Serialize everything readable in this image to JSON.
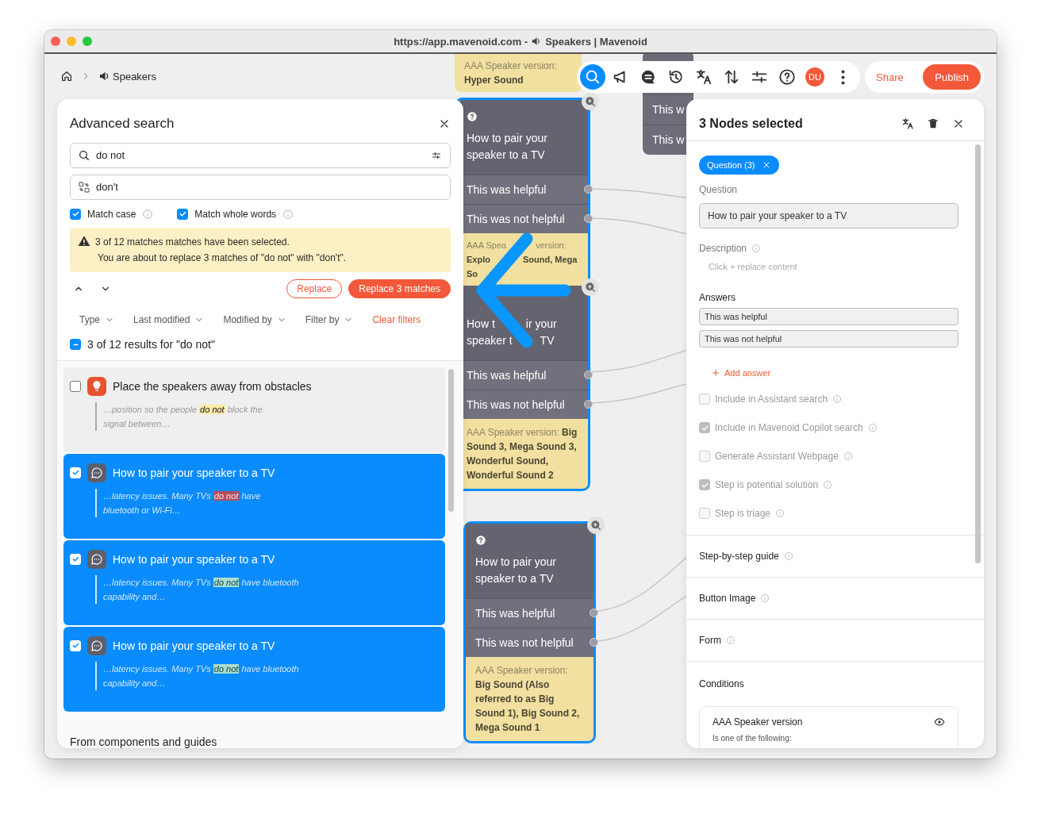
{
  "window": {
    "url": "https://app.mavenoid.com -",
    "title": "Speakers | Mavenoid"
  },
  "breadcrumb": {
    "current": "Speakers"
  },
  "toolbar": {
    "tools": [
      {
        "kind": "search",
        "selected": true
      },
      {
        "kind": "announce",
        "selected": false
      },
      {
        "kind": "chat",
        "selected": false
      },
      {
        "kind": "history",
        "selected": false
      },
      {
        "kind": "translate",
        "selected": false
      },
      {
        "kind": "sort",
        "selected": false
      },
      {
        "kind": "adjust",
        "selected": false
      },
      {
        "kind": "help",
        "selected": false
      }
    ],
    "avatar": "DU",
    "actions": [
      {
        "label": "Share",
        "kind": "text"
      },
      {
        "label": "Publish",
        "kind": "primary"
      }
    ]
  },
  "canvas": {
    "snippet": {
      "label": "AAA Speaker version:",
      "value": "Hyper Sound"
    },
    "groups": [
      {
        "selected": true,
        "nodes": [
          {
            "title": "How to pair your speaker to a TV",
            "answers": [
              "This was helpful",
              "This was not helpful"
            ],
            "condition_parts": {
              "label": [
                "AAA Spea",
                "version:"
              ],
              "value": [
                [
                  "Explo",
                  "Sound, Mega"
                ],
                [
                  "So"
                ]
              ]
            }
          },
          {
            "title_parts": [
              [
                "How t",
                "ir your"
              ],
              [
                "speaker t",
                "TV"
              ]
            ],
            "answers": [
              "This was helpful",
              "This was not helpful"
            ],
            "condition": {
              "label": "AAA Speaker version:",
              "value": "Big Sound 3, Mega Sound 3, Wonderful Sound, Wonderful Sound 2"
            }
          }
        ]
      },
      {
        "selected": true,
        "nodes": [
          {
            "title": "How to pair your speaker to a TV",
            "answers": [
              "This was helpful",
              "This was not helpful"
            ],
            "condition": {
              "label": "AAA Speaker version:",
              "value": "Big Sound (Also referred to as Big Sound 1), Big Sound 2, Mega Sound 1"
            }
          }
        ]
      }
    ],
    "side_node": {
      "answers": [
        "This w",
        "This w"
      ]
    }
  },
  "search_panel": {
    "title": "Advanced search",
    "query": "do not",
    "replacement": "don't",
    "options": [
      {
        "label": "Match case",
        "checked": true
      },
      {
        "label": "Match whole words",
        "checked": true
      }
    ],
    "notice": {
      "title": "3 of 12 matches matches have been selected.",
      "text": "You are about to replace 3 matches of \"do not\" with \"don't\"."
    },
    "buttons": [
      {
        "label": "Replace",
        "kind": "outline"
      },
      {
        "label": "Replace 3 matches",
        "kind": "primary"
      }
    ],
    "filters": [
      {
        "label": "Type",
        "kind": "dropdown"
      },
      {
        "label": "Last modified",
        "kind": "dropdown"
      },
      {
        "label": "Modified by",
        "kind": "dropdown"
      },
      {
        "label": "Filter by",
        "kind": "dropdown"
      },
      {
        "label": "Clear filters",
        "kind": "link"
      }
    ],
    "summary": {
      "text": "3 of 12 results for \"do not\"",
      "indeterminate": true
    },
    "results": [
      {
        "kind": "solution",
        "title": "Place the speakers away from obstacles",
        "selected": false,
        "current": false,
        "snippet": {
          "before": "…position so the people ",
          "match": "do not",
          "after": " block the\nsignal between…"
        }
      },
      {
        "kind": "question",
        "title": "How to pair your speaker to a TV",
        "selected": true,
        "current": true,
        "snippet": {
          "before": "…latency issues. Many TVs ",
          "match": "do not",
          "after": " have\nbluetooth or Wi-Fi…"
        }
      },
      {
        "kind": "question",
        "title": "How to pair your speaker to a TV",
        "selected": true,
        "current": false,
        "snippet": {
          "before": "…latency issues. Many TVs ",
          "match": "do not",
          "after": " have bluetooth\ncapability and…"
        }
      },
      {
        "kind": "question",
        "title": "How to pair your speaker to a TV",
        "selected": true,
        "current": false,
        "snippet": {
          "before": "…latency issues. Many TVs ",
          "match": "do not",
          "after": " have bluetooth\ncapability and…"
        }
      }
    ],
    "section_heading": "From components and guides"
  },
  "inspector": {
    "title": "3 Nodes selected",
    "chips": [
      "Question (3)"
    ],
    "question_label": "Question",
    "question": "How to pair your speaker to a TV",
    "description_label": "Description",
    "description_placeholder": "Click + replace content",
    "answers_label": "Answers",
    "answers": [
      "This was helpful",
      "This was not helpful"
    ],
    "add_answer": "Add answer",
    "options": [
      {
        "label": "Include in Assistant search",
        "checked": false,
        "disabled": true
      },
      {
        "label": "Include in Mavenoid Copilot search",
        "checked": true,
        "disabled": true
      },
      {
        "label": "Generate Assistant Webpage",
        "checked": false,
        "disabled": true
      },
      {
        "label": "Step is potential solution",
        "checked": true,
        "disabled": true
      },
      {
        "label": "Step is triage",
        "checked": false,
        "disabled": true
      }
    ],
    "sections": [
      "Step-by-step guide",
      "Button Image",
      "Form"
    ],
    "conditions": {
      "heading": "Conditions",
      "cards": [
        {
          "title": "AAA Speaker version",
          "subtitle": "Is one of the following:"
        }
      ]
    }
  }
}
